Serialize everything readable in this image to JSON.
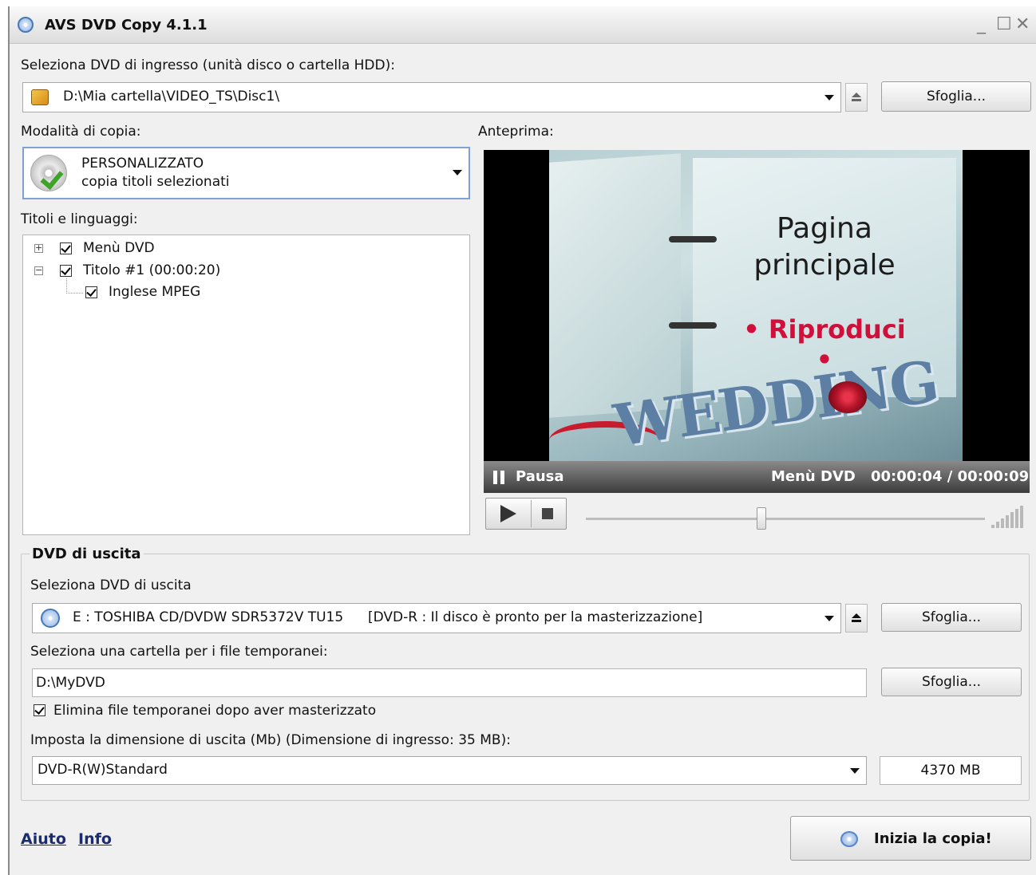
{
  "window": {
    "title": "AVS DVD Copy 4.1.1",
    "minimize": "_",
    "maximize": "☐",
    "close": "✕"
  },
  "input": {
    "label": "Seleziona DVD di ingresso (unità disco o cartella HDD):",
    "value": "D:\\Mia cartella\\VIDEO_TS\\Disc1\\",
    "browse": "Sfoglia..."
  },
  "copy_mode": {
    "label": "Modalità di copia:",
    "title": "PERSONALIZZATO",
    "subtitle": "copia titoli selezionati"
  },
  "titles": {
    "label": "Titoli e linguaggi:",
    "items": [
      {
        "label": "Menù DVD",
        "checked": true,
        "expander": "+"
      },
      {
        "label": "Titolo #1 (00:00:20)",
        "checked": true,
        "expander": "−"
      },
      {
        "label": "Inglese MPEG",
        "checked": true
      }
    ]
  },
  "preview": {
    "label": "Anteprima:",
    "scene_title_line1": "Pagina",
    "scene_title_line2": "principale",
    "scene_play": "• Riproduci •",
    "scene_logo": "WEDDING",
    "status": "Pausa",
    "section": "Menù DVD",
    "time": "00:00:04 / 00:00:09",
    "progress": 0.44
  },
  "output": {
    "group_title": "DVD di uscita",
    "drive_label": "Seleziona DVD di uscita",
    "drive_value": "E : TOSHIBA  CD/DVDW SDR5372V TU15",
    "drive_status": "[DVD-R : Il disco è pronto per la masterizzazione]",
    "drive_browse": "Sfoglia...",
    "temp_label": "Seleziona una cartella per i file temporanei:",
    "temp_value": "D:\\MyDVD",
    "temp_browse": "Sfoglia...",
    "delete_temp": "Elimina file temporanei dopo aver masterizzato",
    "delete_temp_checked": true,
    "size_label": "Imposta la dimensione di uscita (Mb) (Dimensione di ingresso: 35 MB):",
    "size_preset": "DVD-R(W)Standard",
    "size_value": "4370 MB"
  },
  "footer": {
    "help": "Aiuto",
    "info": "Info",
    "start": "Inizia la copia!"
  },
  "colors": {
    "accent_border": "#7ea2d6",
    "play_text": "#d0103a",
    "link": "#1a2c6e"
  }
}
